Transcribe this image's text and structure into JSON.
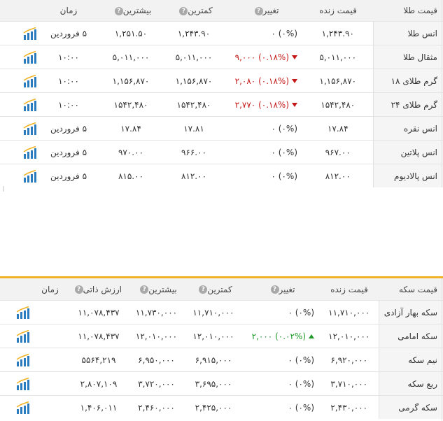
{
  "gold": {
    "headers": {
      "name": "قیمت طلا",
      "live": "قیمت زنده",
      "change": "تغییر",
      "low": "کمترین",
      "high": "بیشترین",
      "time": "زمان"
    },
    "rows": [
      {
        "name": "انس طلا",
        "live": "۱,۲۴۳.۹۰",
        "change_value": "",
        "change_pct": "(۰%)",
        "change_tail": "۰",
        "direction": "none",
        "low": "۱,۲۴۳.۹۰",
        "high": "۱,۲۵۱.۵۰",
        "time": "۵ فروردین"
      },
      {
        "name": "مثقال طلا",
        "live": "۵,۰۱۱,۰۰۰",
        "change_value": "۹,۰۰۰",
        "change_pct": "(۰.۱۸%)",
        "change_tail": "",
        "direction": "down",
        "low": "۵,۰۱۱,۰۰۰",
        "high": "۵,۰۱۱,۰۰۰",
        "time": "۱۰:۰۰"
      },
      {
        "name": "گرم طلای ۱۸",
        "live": "۱,۱۵۶,۸۷۰",
        "change_value": "۲,۰۸۰",
        "change_pct": "(۰.۱۸%)",
        "change_tail": "",
        "direction": "down",
        "low": "۱,۱۵۶,۸۷۰",
        "high": "۱,۱۵۶,۸۷۰",
        "time": "۱۰:۰۰"
      },
      {
        "name": "گرم طلای ۲۴",
        "live": "۱۵۴۲,۴۸۰",
        "change_value": "۲,۷۷۰",
        "change_pct": "(۰.۱۸%)",
        "change_tail": "",
        "direction": "down",
        "low": "۱۵۴۲,۴۸۰",
        "high": "۱۵۴۲,۴۸۰",
        "time": "۱۰:۰۰"
      },
      {
        "name": "انس نقره",
        "live": "۱۷.۸۴",
        "change_value": "",
        "change_pct": "(۰%)",
        "change_tail": "۰",
        "direction": "none",
        "low": "۱۷.۸۱",
        "high": "۱۷.۸۴",
        "time": "۵ فروردین"
      },
      {
        "name": "انس پلاتین",
        "live": "۹۶۷.۰۰",
        "change_value": "",
        "change_pct": "(۰%)",
        "change_tail": "۰",
        "direction": "none",
        "low": "۹۶۶.۰۰",
        "high": "۹۷۰.۰۰",
        "time": "۵ فروردین"
      },
      {
        "name": "انس پالادیوم",
        "live": "۸۱۲.۰۰",
        "change_value": "",
        "change_pct": "(۰%)",
        "change_tail": "۰",
        "direction": "none",
        "low": "۸۱۲.۰۰",
        "high": "۸۱۵.۰۰",
        "time": "۵ فروردین"
      }
    ]
  },
  "coin": {
    "headers": {
      "name": "قیمت سکه",
      "live": "قیمت زنده",
      "change": "تغییر",
      "low": "کمترین",
      "high": "بیشترین",
      "intrinsic": "ارزش ذاتی",
      "time": "زمان"
    },
    "rows": [
      {
        "name": "سکه بهار آزادی",
        "live": "۱۱,۷۱۰,۰۰۰",
        "change_value": "",
        "change_pct": "(۰%)",
        "change_tail": "۰",
        "direction": "none",
        "low": "۱۱,۷۱۰,۰۰۰",
        "high": "۱۱,۷۳۰,۰۰۰",
        "intrinsic": "۱۱,۰۷۸,۴۳۷",
        "time": ""
      },
      {
        "name": "سکه امامی",
        "live": "۱۲,۰۱۰,۰۰۰",
        "change_value": "۲,۰۰۰",
        "change_pct": "(۰.۰۲%)",
        "change_tail": "",
        "direction": "up",
        "low": "۱۲,۰۱۰,۰۰۰",
        "high": "۱۲,۰۱۰,۰۰۰",
        "intrinsic": "۱۱,۰۷۸,۴۳۷",
        "time": ""
      },
      {
        "name": "نیم سکه",
        "live": "۶,۹۲۰,۰۰۰",
        "change_value": "",
        "change_pct": "(۰%)",
        "change_tail": "۰",
        "direction": "none",
        "low": "۶,۹۱۵,۰۰۰",
        "high": "۶,۹۵۰,۰۰۰",
        "intrinsic": "۵۵۶۴,۲۱۹",
        "time": ""
      },
      {
        "name": "ربع سکه",
        "live": "۳,۷۱۰,۰۰۰",
        "change_value": "",
        "change_pct": "(۰%)",
        "change_tail": "۰",
        "direction": "none",
        "low": "۳,۶۹۵,۰۰۰",
        "high": "۳,۷۲۰,۰۰۰",
        "intrinsic": "۲,۸۰۷,۱۰۹",
        "time": ""
      },
      {
        "name": "سکه گرمی",
        "live": "۲,۴۳۰,۰۰۰",
        "change_value": "",
        "change_pct": "(۰%)",
        "change_tail": "۰",
        "direction": "none",
        "low": "۲,۴۲۵,۰۰۰",
        "high": "۲,۴۶۰,۰۰۰",
        "intrinsic": "۱,۴۰۶,۰۱۱",
        "time": ""
      }
    ]
  },
  "icons": {
    "help": "question-circle-icon",
    "chart": "bar-chart-icon",
    "down": "down-triangle-icon",
    "up": "up-triangle-icon"
  },
  "colors": {
    "accent": "#f0b323",
    "negative": "#c41818",
    "positive": "#1d9a2a",
    "help_icon": "#a9a9a9",
    "chart_icon_bars": "#2b7bbf",
    "chart_icon_line": "#f0b323"
  }
}
